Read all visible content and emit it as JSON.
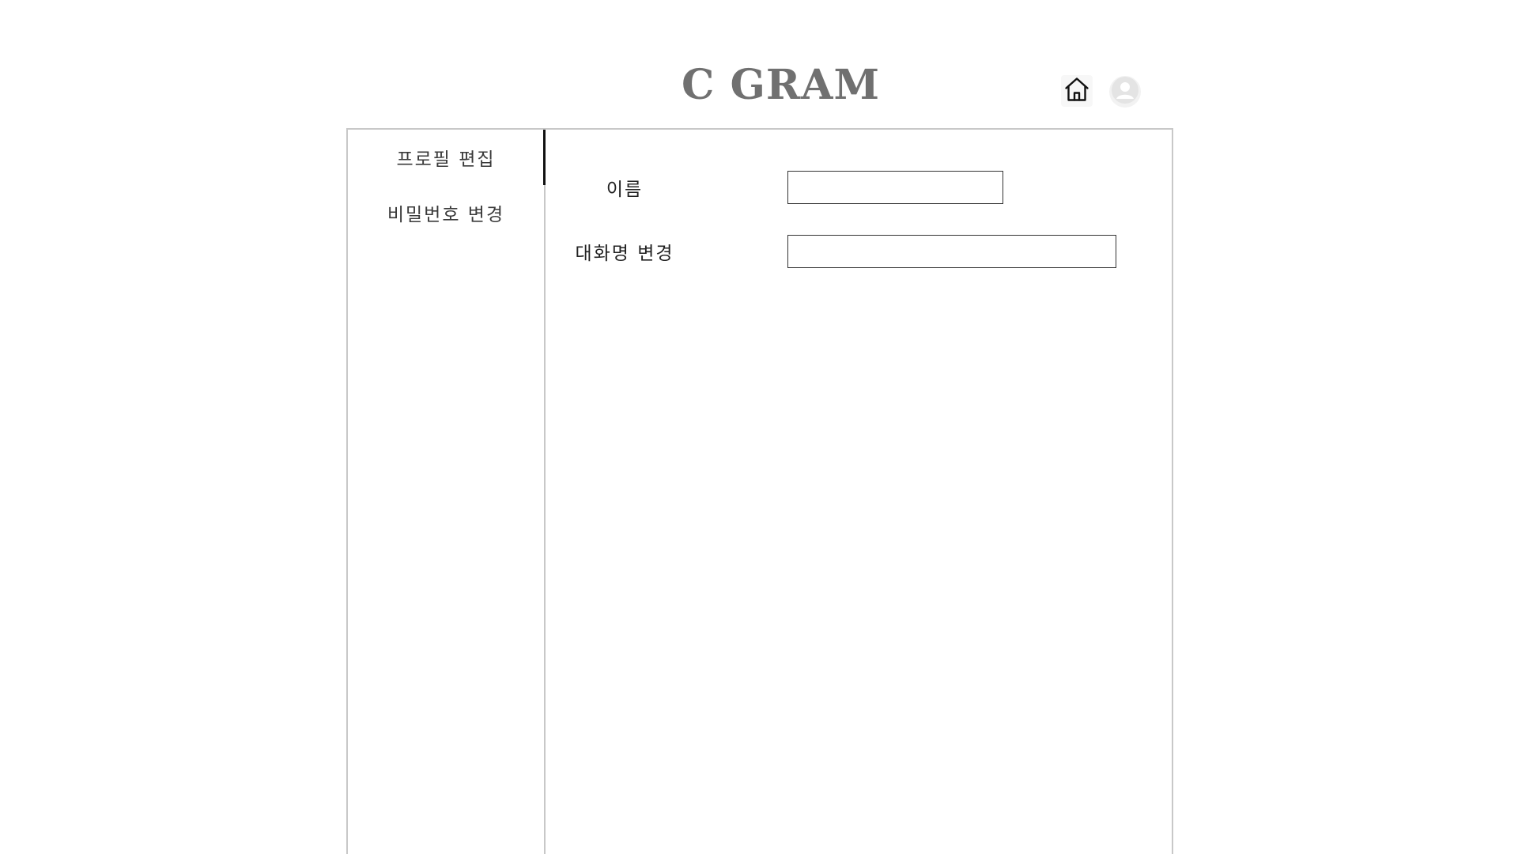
{
  "header": {
    "logo_text": "C GRAM",
    "home_icon": "home-icon",
    "avatar_icon": "user-avatar-icon"
  },
  "sidebar": {
    "items": [
      {
        "label": "프로필 편집",
        "active": true
      },
      {
        "label": "비밀번호 변경",
        "active": false
      }
    ]
  },
  "form": {
    "name_label": "이름",
    "name_value": "",
    "nickname_label": "대화명 변경",
    "nickname_value": ""
  },
  "colors": {
    "logo": "#707070",
    "border": "#c8c8c8",
    "active_indicator": "#111111"
  }
}
